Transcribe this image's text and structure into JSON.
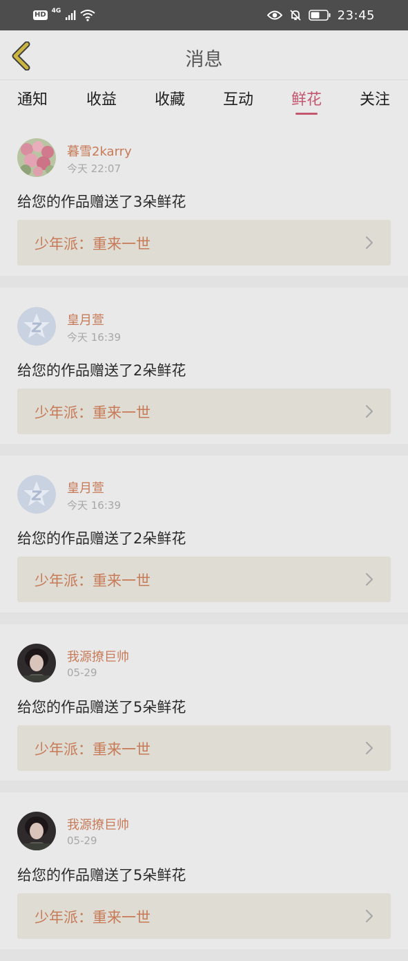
{
  "status_bar": {
    "hd": "HD",
    "network": "4G",
    "time": "23:45",
    "icons": [
      "signal-icon",
      "wifi-icon",
      "eye-icon",
      "bell-off-icon",
      "battery-icon"
    ]
  },
  "header": {
    "title": "消息",
    "back_icon": "chevron-left-icon",
    "accent": "#c2576f",
    "back_color": "#ccb642"
  },
  "tabs": [
    {
      "label": "通知",
      "active": false
    },
    {
      "label": "收益",
      "active": false
    },
    {
      "label": "收藏",
      "active": false
    },
    {
      "label": "互动",
      "active": false
    },
    {
      "label": "鲜花",
      "active": true
    },
    {
      "label": "关注",
      "active": false
    }
  ],
  "messages": [
    {
      "user": "暮雪2karry",
      "time": "今天 22:07",
      "text": "给您的作品赠送了3朵鲜花",
      "work": "少年派：重来一世",
      "avatar": "flower-avatar"
    },
    {
      "user": "皇月萱",
      "time": "今天 16:39",
      "text": "给您的作品赠送了2朵鲜花",
      "work": "少年派：重来一世",
      "avatar": "default-avatar"
    },
    {
      "user": "皇月萱",
      "time": "今天 16:39",
      "text": "给您的作品赠送了2朵鲜花",
      "work": "少年派：重来一世",
      "avatar": "default-avatar"
    },
    {
      "user": "我源撩巨帅",
      "time": "05-29",
      "text": "给您的作品赠送了5朵鲜花",
      "work": "少年派：重来一世",
      "avatar": "photo-avatar"
    },
    {
      "user": "我源撩巨帅",
      "time": "05-29",
      "text": "给您的作品赠送了5朵鲜花",
      "work": "少年派：重来一世",
      "avatar": "photo-avatar"
    }
  ]
}
